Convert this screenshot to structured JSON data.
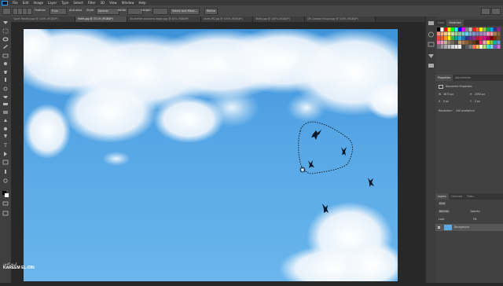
{
  "menubar": {
    "items": [
      "File",
      "Edit",
      "Image",
      "Layer",
      "Type",
      "Select",
      "Filter",
      "3D",
      "View",
      "Window",
      "Help"
    ]
  },
  "options_bar": {
    "feather_label": "Feather:",
    "feather_value": "0 px",
    "anti_alias_label": "Anti-alias",
    "style_label": "Style:",
    "style_value": "Normal",
    "width_label": "Width:",
    "height_label": "Height:",
    "select_and_mask_label": "Select and Mask...",
    "refine_label": "Refine"
  },
  "document_tabs": [
    {
      "label": "Sport Healthy.jpg @ 100% (RGB/8*)",
      "active": false
    },
    {
      "label": "Fakht.jpg @ 33.1% (RGB/8*)",
      "active": true
    },
    {
      "label": "3d-mother-and-sons-eagle.jpg @ 50% (RGB/8*)",
      "active": false
    },
    {
      "label": "shirts-PG.jpg @ 100% (RGB/8*)",
      "active": false
    },
    {
      "label": "Teddy.jpg @ 100% (RGB/8*)",
      "active": false
    },
    {
      "label": "GR-Cartoon House.jpg @ 100% (RGB/8*)",
      "active": false
    }
  ],
  "panels": {
    "color_tabs": [
      "Color",
      "Swatches"
    ],
    "properties_tabs": [
      "Properties",
      "Adjustments"
    ],
    "properties_title": "Document Properties",
    "width_label": "W",
    "width_value": "3872 px",
    "height_label": "H",
    "height_value": "2592 px",
    "x_label": "X",
    "x_value": "0 px",
    "y_label": "Y",
    "y_value": "0 px",
    "resolution_label": "Resolution:",
    "resolution_value": "240 pixels/inch",
    "layers_tabs": [
      "Layers",
      "Channels",
      "Paths"
    ],
    "layers_kind": "Kind",
    "layers_blend_mode": "Normal",
    "layers_opacity_label": "Opacity:",
    "layers_fill_label": "Fill:",
    "layers_lock_label": "Lock:",
    "background_layer_name": "Background"
  },
  "watermark": {
    "arabic_text": "كريم الدين",
    "name_line1": "KAREEM",
    "name_line2": "EL-DIN"
  },
  "colors": {
    "ui_dark": "#282828",
    "ui_panel": "#414141",
    "sky_top": "#3e93d9",
    "sky_bottom": "#6ab6ec",
    "accent_blue": "#2fa3f7"
  },
  "swatch_colors": [
    "#000000",
    "#ffffff",
    "#ff0000",
    "#ffff00",
    "#00ff00",
    "#00ffff",
    "#0000ff",
    "#ff00ff",
    "#808080",
    "#c0c0c0",
    "#ed1c24",
    "#f26522",
    "#fff200",
    "#8dc63f",
    "#00a651",
    "#00aeef",
    "#2e3192",
    "#92278f",
    "#f7977a",
    "#f9ad81",
    "#fdc68a",
    "#fff79a",
    "#c4df9b",
    "#a3d39c",
    "#82ca9d",
    "#7bcdc8",
    "#6ecff6",
    "#7ea7d8",
    "#8493ca",
    "#8882be",
    "#a187be",
    "#bc8dbf",
    "#f49ac2",
    "#f6989d",
    "#a67c52",
    "#8c6239",
    "#ef4136",
    "#f15a29",
    "#f7941d",
    "#fff200",
    "#39b54a",
    "#00a99d",
    "#27aae1",
    "#1c75bc",
    "#2b3990",
    "#662d91",
    "#92278f",
    "#be1e2d",
    "#d91f5b",
    "#ec008c",
    "#9e005d",
    "#790000",
    "#7b2e00",
    "#754c24",
    "#f06eaa",
    "#f49ac1",
    "#c2b59b",
    "#998675",
    "#736357",
    "#534741",
    "#c69c6d",
    "#a67c52",
    "#8c6239",
    "#754c24",
    "#603913",
    "#3c2415",
    "#ee2a7b",
    "#f7a8b8",
    "#ffde17",
    "#8dc63f",
    "#00b2a9",
    "#5e9ad7",
    "#6d6e71",
    "#939598",
    "#a7a9ac",
    "#bcbec0",
    "#d1d3d4",
    "#e6e7e8",
    "#f1f2f2",
    "#414042",
    "#58595b",
    "#808285",
    "#ff6f61",
    "#ffb347",
    "#fffacd",
    "#b0e57c",
    "#40e0d0",
    "#87ceeb",
    "#6a5acd",
    "#da70d6"
  ]
}
